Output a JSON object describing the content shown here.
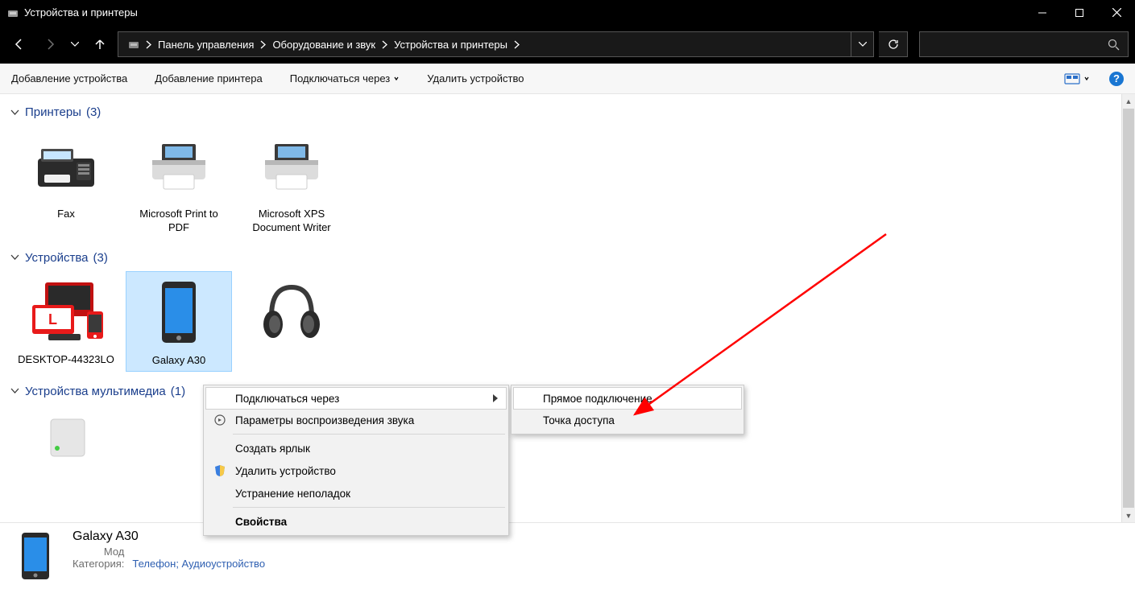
{
  "window": {
    "title": "Устройства и принтеры"
  },
  "breadcrumb": {
    "items": [
      "Панель управления",
      "Оборудование и звук",
      "Устройства и принтеры"
    ]
  },
  "commands": {
    "add_device": "Добавление устройства",
    "add_printer": "Добавление принтера",
    "connect_via": "Подключаться через",
    "remove_device": "Удалить устройство"
  },
  "groups": {
    "printers": {
      "label": "Принтеры",
      "count": "(3)"
    },
    "devices": {
      "label": "Устройства",
      "count": "(3)"
    },
    "multimedia": {
      "label": "Устройства мультимедиа",
      "count": "(1)"
    }
  },
  "printers": [
    {
      "name": "Fax"
    },
    {
      "name": "Microsoft Print to PDF"
    },
    {
      "name": "Microsoft XPS Document Writer"
    }
  ],
  "devices": [
    {
      "name": "DESKTOP-44323LO"
    },
    {
      "name": "Galaxy A30"
    },
    {
      "name": ""
    }
  ],
  "details": {
    "title": "Galaxy A30",
    "model_label": "Мод",
    "category_label": "Категория:",
    "category_value": "Телефон; Аудиоустройство"
  },
  "context_menu": {
    "connect_via": "Подключаться через",
    "sound_params": "Параметры воспроизведения звука",
    "create_shortcut": "Создать ярлык",
    "remove": "Удалить устройство",
    "troubleshoot": "Устранение неполадок",
    "properties": "Свойства"
  },
  "submenu": {
    "direct": "Прямое подключение",
    "access_point": "Точка доступа"
  }
}
